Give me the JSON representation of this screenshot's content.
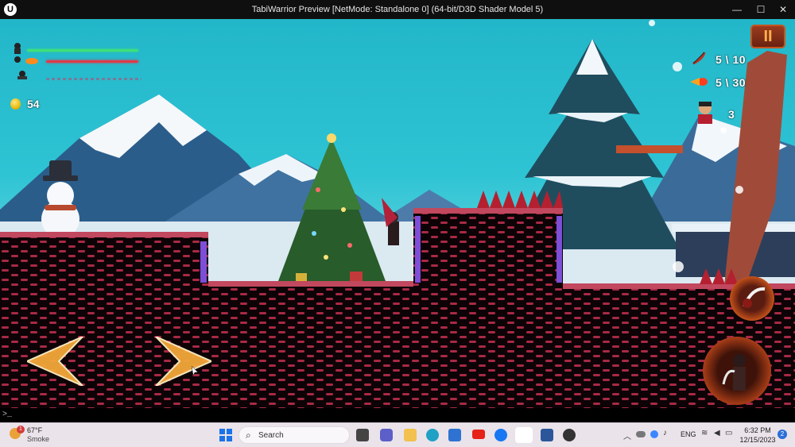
{
  "window": {
    "title": "TabiWarrior Preview [NetMode: Standalone 0]  (64-bit/D3D Shader Model 5)",
    "logo": "U",
    "controls": {
      "minimize": "—",
      "maximize": "☐",
      "close": "✕"
    }
  },
  "hud": {
    "coins": "54",
    "pause_label": "II",
    "stats": [
      {
        "icon": "bow-icon",
        "value": "5 \\ 10"
      },
      {
        "icon": "fireball-icon",
        "value": "5 \\ 30"
      },
      {
        "icon": "warrior-portrait-icon",
        "value": "3"
      }
    ],
    "bars": [
      {
        "name": "health",
        "color": "#3ee07a",
        "level": 1.0
      },
      {
        "name": "energy",
        "color": "#e03a4a",
        "level": 1.0
      },
      {
        "name": "special",
        "color": "#7a7a9a",
        "level": 0.0
      }
    ]
  },
  "console": {
    "prompt": ">_"
  },
  "taskbar": {
    "weather": {
      "temp": "67°F",
      "condition": "Smoke",
      "badge": "1"
    },
    "search_placeholder": "Search",
    "lang": "ENG",
    "time": "6:32 PM",
    "date": "12/15/2023",
    "notification_count": "2"
  }
}
